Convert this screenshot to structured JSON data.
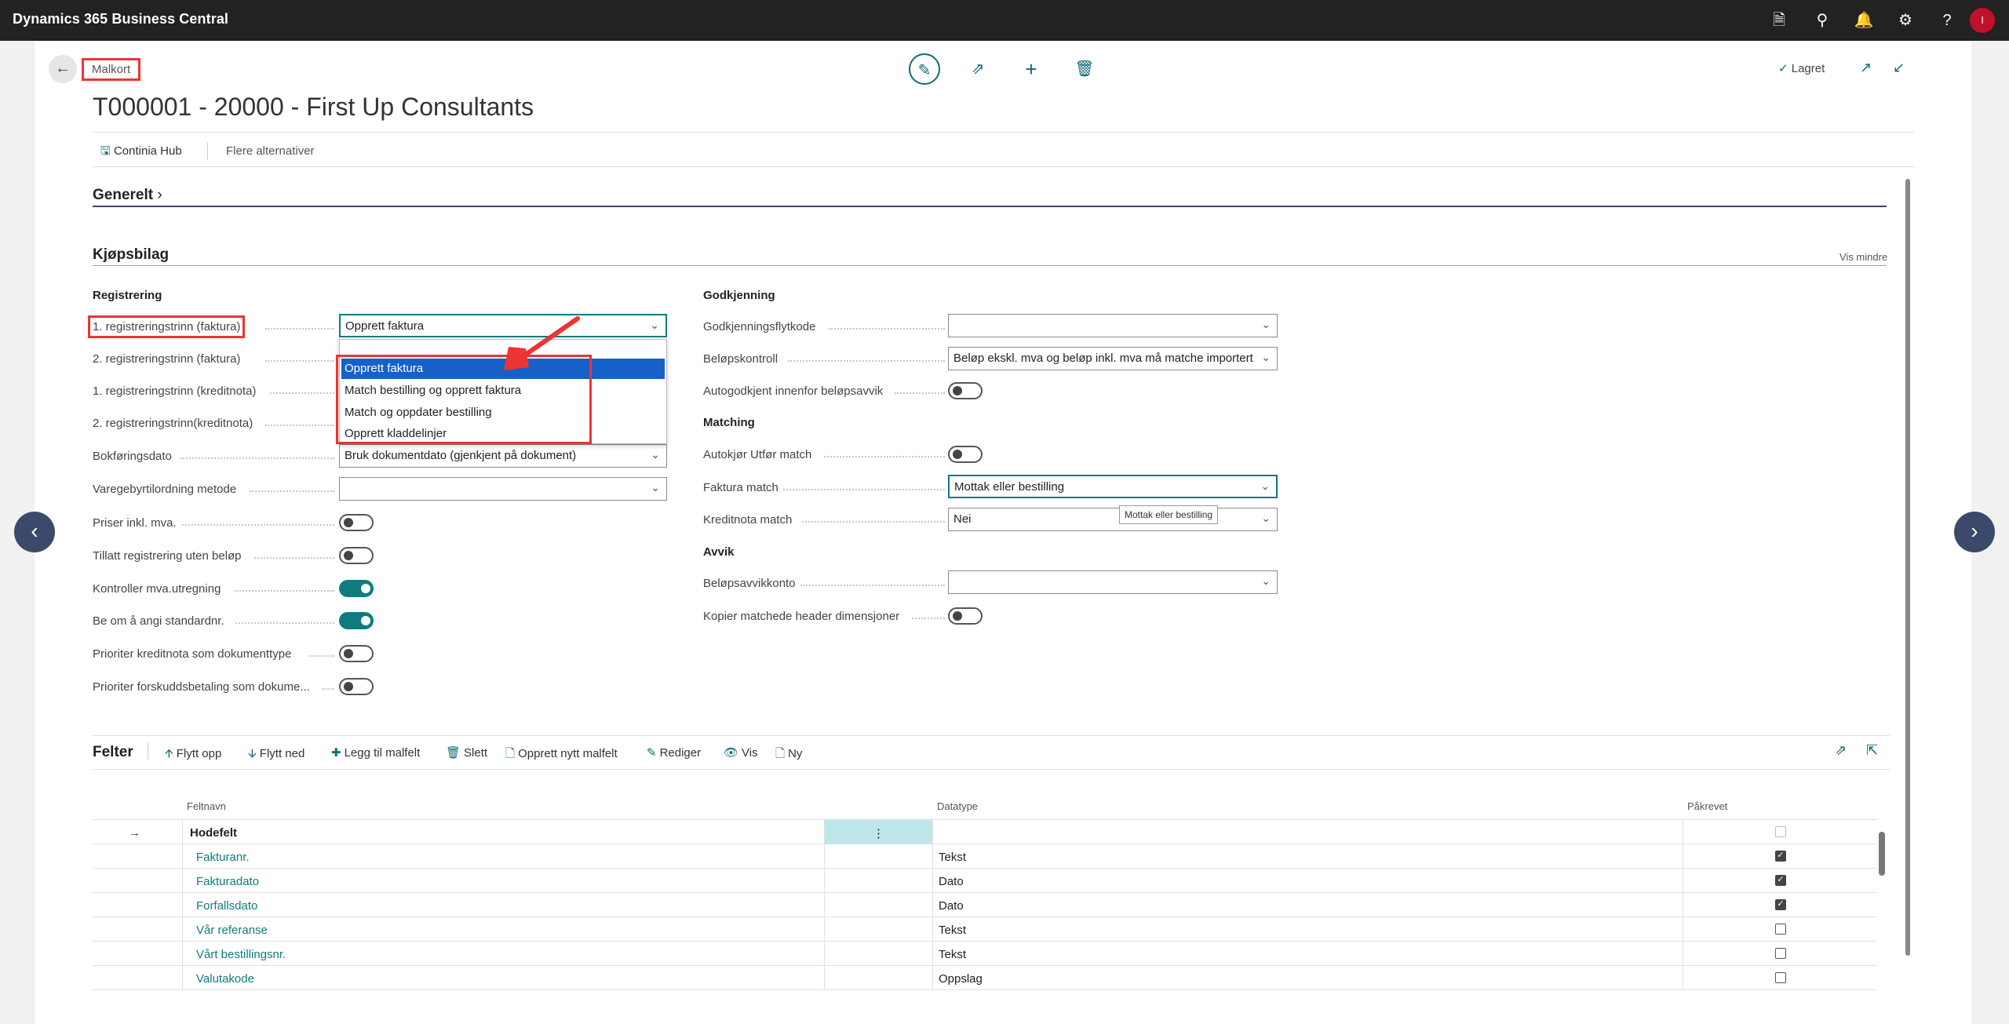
{
  "app": {
    "title": "Dynamics 365 Business Central",
    "avatar": "I"
  },
  "topbar_icons": [
    "document-icon",
    "search-icon",
    "bell-icon",
    "gear-icon",
    "help-icon"
  ],
  "page": {
    "breadcrumb": "Malkort",
    "title": "T000001 - 20000 - First Up Consultants",
    "saved": "Lagret"
  },
  "actions": {
    "hub": "Continia Hub",
    "more": "Flere alternativer"
  },
  "sections": {
    "general": "Generelt",
    "purchase": "Kjøpsbilag",
    "show_less": "Vis mindre"
  },
  "left": {
    "group": "Registrering",
    "fields": [
      {
        "label": "1. registreringstrinn (faktura)",
        "value": "Opprett faktura"
      },
      {
        "label": "2. registreringstrinn (faktura)"
      },
      {
        "label": "1. registreringstrinn (kreditnota)"
      },
      {
        "label": "2. registreringstrinn(kreditnota)"
      },
      {
        "label": "Bokføringsdato",
        "value": "Bruk dokumentdato (gjenkjent på dokument)"
      },
      {
        "label": "Varegebyrtilordning metode",
        "value": ""
      },
      {
        "label": "Priser inkl. mva.",
        "toggle": false
      },
      {
        "label": "Tillatt registrering uten beløp",
        "toggle": false
      },
      {
        "label": "Kontroller mva.utregning",
        "toggle": true
      },
      {
        "label": "Be om å angi standardnr.",
        "toggle": true
      },
      {
        "label": "Prioriter kreditnota som dokumenttype",
        "toggle": false
      },
      {
        "label": "Prioriter forskuddsbetaling som dokume...",
        "toggle": false
      }
    ]
  },
  "dropdown": {
    "options": [
      "Opprett faktura",
      "Match bestilling og opprett faktura",
      "Match og oppdater bestilling",
      "Opprett kladdelinjer"
    ],
    "selected": "Opprett faktura"
  },
  "right": {
    "approval": "Godkjenning",
    "approval_flow": {
      "label": "Godkjenningsflytkode",
      "value": ""
    },
    "amount_check": {
      "label": "Beløpskontroll",
      "value": "Beløp ekskl. mva og beløp inkl. mva må matche importert"
    },
    "auto_approve": {
      "label": "Autogodkjent innenfor beløpsavvik",
      "toggle": false
    },
    "matching": "Matching",
    "auto_match": {
      "label": "Autokjør Utfør match",
      "toggle": false
    },
    "invoice_match": {
      "label": "Faktura match",
      "value": "Mottak eller bestilling"
    },
    "credit_match": {
      "label": "Kreditnota match",
      "value": "Nei"
    },
    "tooltip": "Mottak eller bestilling",
    "deviation": "Avvik",
    "deviation_account": {
      "label": "Beløpsavvikkonto",
      "value": ""
    },
    "copy_dims": {
      "label": "Kopier matchede header dimensjoner",
      "toggle": false
    }
  },
  "fields_part": {
    "title": "Felter",
    "buttons": [
      "Flytt opp",
      "Flytt ned",
      "Legg til malfelt",
      "Slett",
      "Opprett nytt malfelt",
      "Rediger",
      "Vis",
      "Ny"
    ],
    "columns": {
      "name": "Feltnavn",
      "type": "Datatype",
      "required": "Påkrevet"
    },
    "rows": [
      {
        "name": "Hodefelt",
        "type": "",
        "required": null,
        "bold": true
      },
      {
        "name": "Fakturanr.",
        "type": "Tekst",
        "required": true
      },
      {
        "name": "Fakturadato",
        "type": "Dato",
        "required": true
      },
      {
        "name": "Forfallsdato",
        "type": "Dato",
        "required": true
      },
      {
        "name": "Vår referanse",
        "type": "Tekst",
        "required": false
      },
      {
        "name": "Vårt bestillingsnr.",
        "type": "Tekst",
        "required": false
      },
      {
        "name": "Valutakode",
        "type": "Oppslag",
        "required": false
      }
    ]
  }
}
